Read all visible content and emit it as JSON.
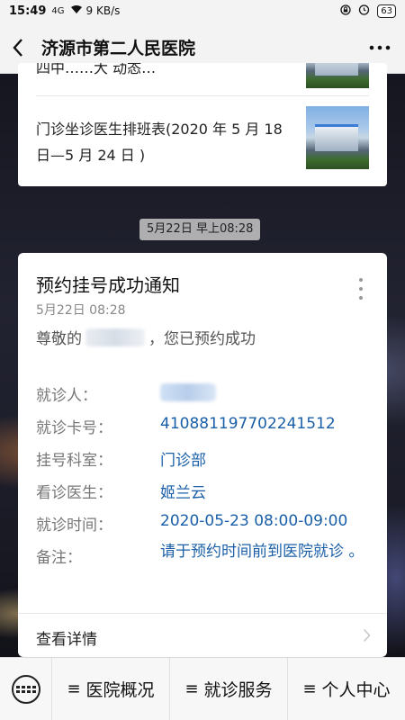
{
  "status_bar": {
    "time": "15:49",
    "signal": "4G",
    "speed": "9 KB/s",
    "battery": "63"
  },
  "nav": {
    "title": "济源市第二人民医院"
  },
  "article_card": {
    "partial_title": "四中……大 动态…",
    "article_title": "门诊坐诊医生排班表(2020 年 5 月 18 日—5 月 24 日 )"
  },
  "timestamp": "5月22日 早上08:28",
  "notice": {
    "title": "预约挂号成功通知",
    "date": "5月22日  08:28",
    "greeting_prefix": "尊敬的",
    "greeting_suffix": "，您已预约成功",
    "fields": [
      {
        "label": "就诊人：",
        "value": ""
      },
      {
        "label": "就诊卡号：",
        "value": "410881197702241512"
      },
      {
        "label": "挂号科室：",
        "value": "门诊部"
      },
      {
        "label": "看诊医生：",
        "value": "姬兰云"
      },
      {
        "label": "就诊时间：",
        "value": "2020-05-23 08:00-09:00"
      },
      {
        "label": "备注：",
        "value": "请于预约时间前到医院就诊 。"
      }
    ],
    "detail_link": "查看详情"
  },
  "bottom_menu": {
    "items": [
      "医院概况",
      "就诊服务",
      "个人中心"
    ]
  }
}
